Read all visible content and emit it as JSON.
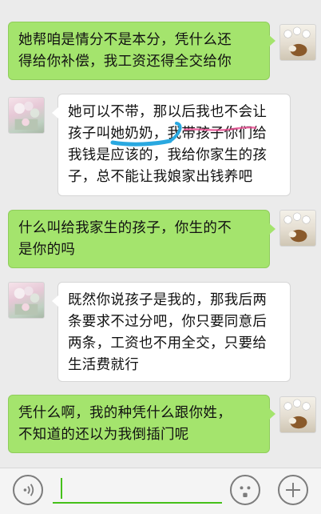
{
  "messages": [
    {
      "side": "right",
      "text": "她帮咱是情分不是本分，凭什么还\n得给你补偿，我工资还得全交给你"
    },
    {
      "side": "left",
      "text": "她可以不带，那以后我也不会让\n孩子叫她奶奶，我带孩子你们给\n我钱是应该的，我给你家生的孩\n子，总不能让我娘家出钱养吧"
    },
    {
      "side": "right",
      "text": "什么叫给我家生的孩子，你生的不\n是你的吗"
    },
    {
      "side": "left",
      "text": "既然你说孩子是我的，那我后两\n条要求不过分吧，你只要同意后\n两条，工资也不用全交，只要给\n生活费就行"
    },
    {
      "side": "right",
      "text": "凭什么啊，我的种凭什么跟你姓，\n不知道的还以为我倒插门呢"
    }
  ],
  "input": {
    "value": ""
  },
  "colors": {
    "background": "#ebebeb",
    "bubble_right": "#a4e46d",
    "bubble_left": "#ffffff",
    "input_accent": "#45c01a"
  },
  "icons": {
    "voice": "voice-icon",
    "emoji": "emoji-icon",
    "plus": "plus-icon"
  }
}
